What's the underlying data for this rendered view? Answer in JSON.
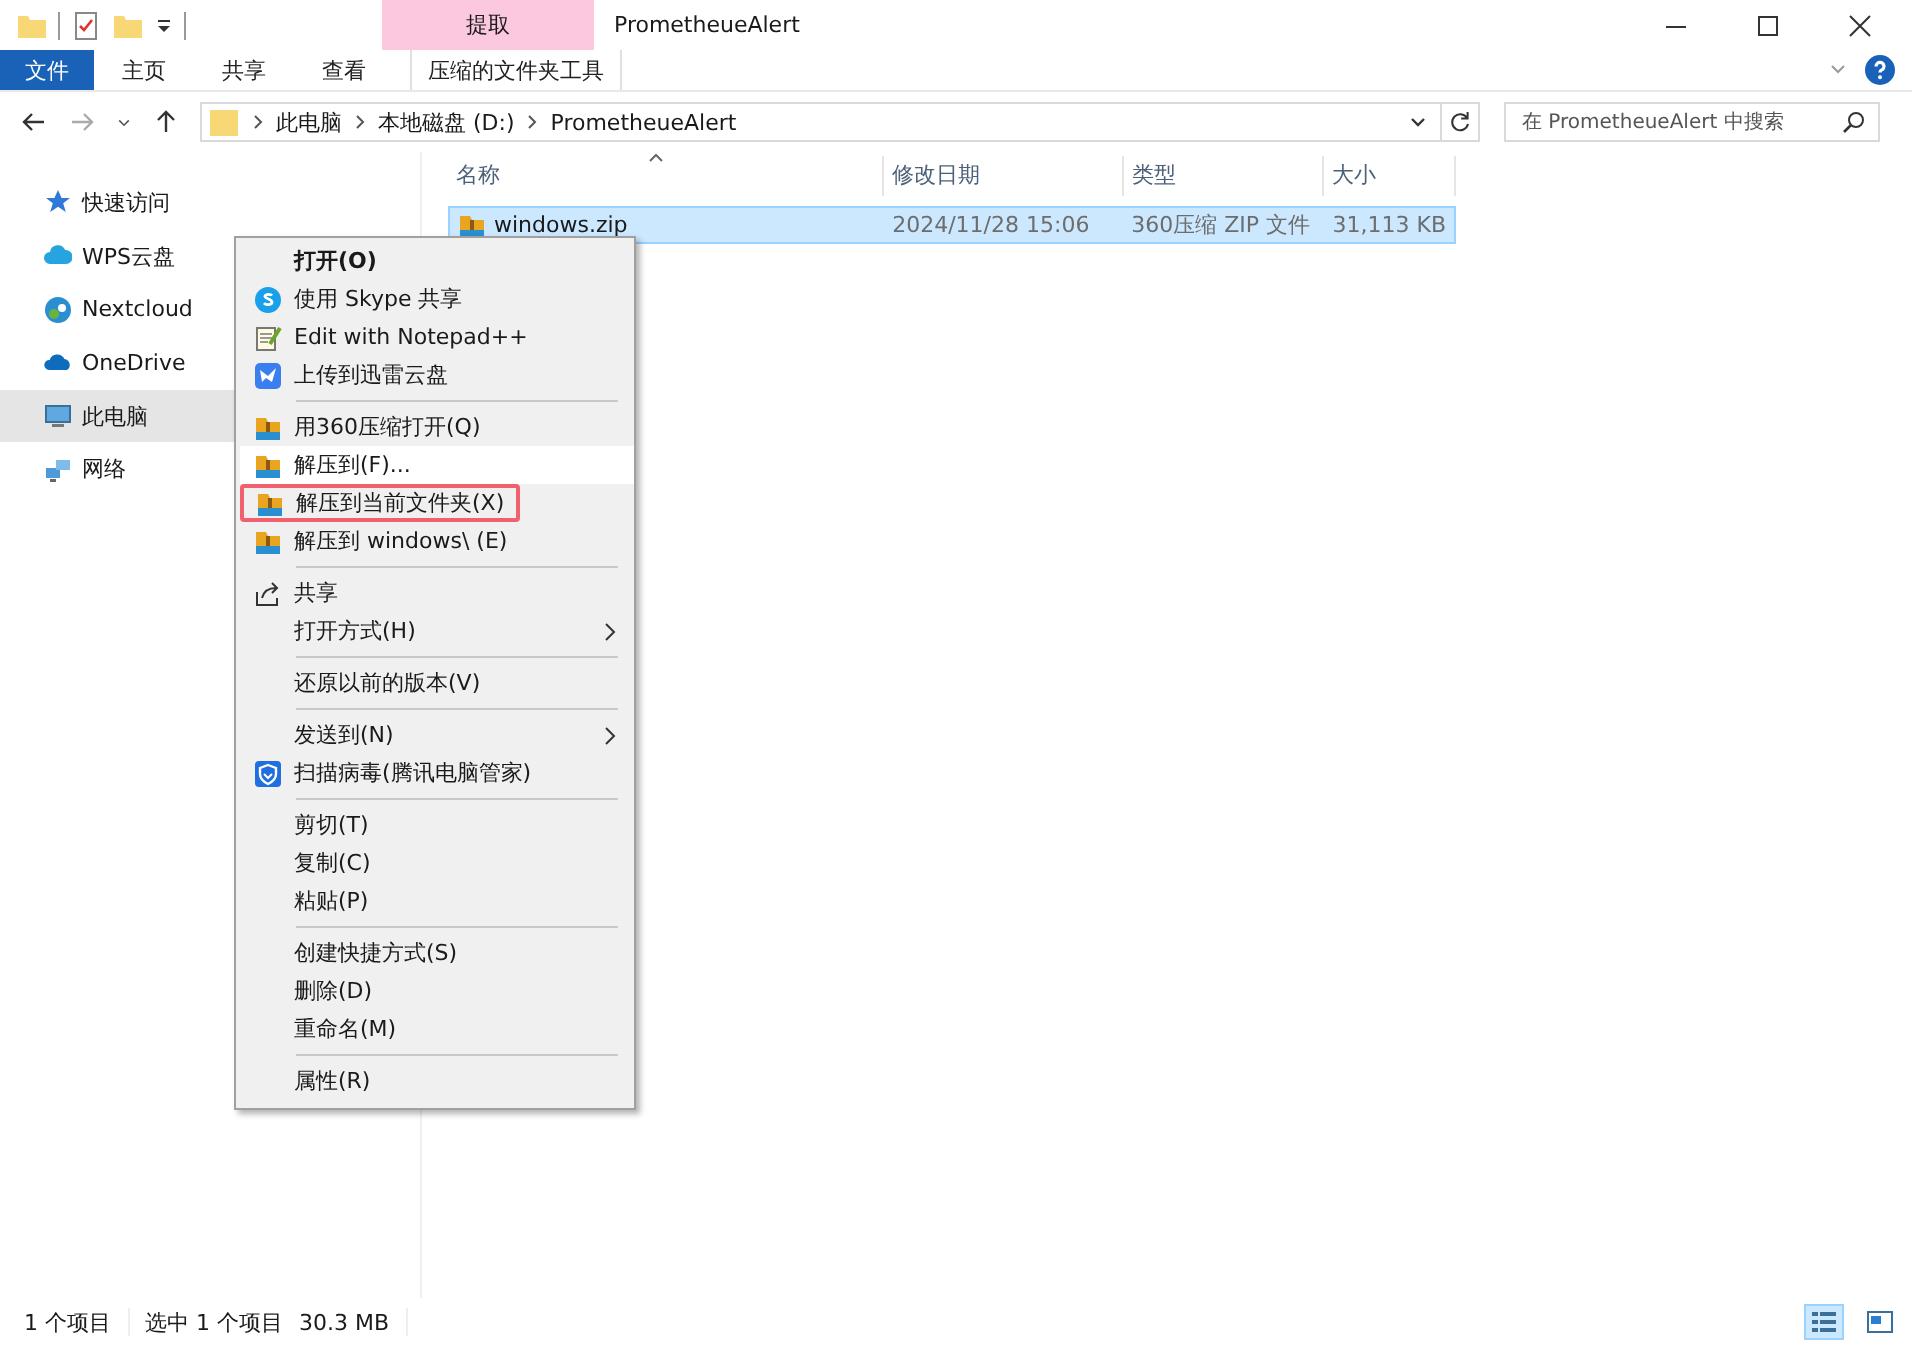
{
  "window": {
    "title": "PrometheueAlert"
  },
  "context_tab": {
    "label": "提取"
  },
  "ribbon_tabs": [
    {
      "label": "文件",
      "kind": "file",
      "selected": false
    },
    {
      "label": "主页",
      "kind": "normal",
      "selected": false
    },
    {
      "label": "共享",
      "kind": "normal",
      "selected": false
    },
    {
      "label": "查看",
      "kind": "normal",
      "selected": false
    },
    {
      "label": "压缩的文件夹工具",
      "kind": "context",
      "selected": false
    }
  ],
  "address": {
    "crumbs": [
      "此电脑",
      "本地磁盘 (D:)",
      "PrometheueAlert"
    ]
  },
  "search": {
    "placeholder": "在 PrometheueAlert 中搜索"
  },
  "sidebar": {
    "items": [
      {
        "label": "快速访问",
        "kind": "star",
        "selected": false
      },
      {
        "label": "WPS云盘",
        "kind": "cloud",
        "selected": false
      },
      {
        "label": "Nextcloud",
        "kind": "nextcloud",
        "selected": false
      },
      {
        "label": "OneDrive",
        "kind": "onedrive",
        "selected": false
      },
      {
        "label": "此电脑",
        "kind": "pc",
        "selected": true
      },
      {
        "label": "网络",
        "kind": "network",
        "selected": false
      }
    ]
  },
  "table": {
    "columns": [
      "名称",
      "修改日期",
      "类型",
      "大小"
    ],
    "rows": [
      {
        "name": "windows.zip",
        "date": "2024/11/28 15:06",
        "type": "360压缩 ZIP 文件",
        "size": "31,113 KB",
        "selected": true
      }
    ]
  },
  "context_menu": {
    "groups": [
      [
        {
          "label": "打开(O)",
          "kind": "plain",
          "bold": true,
          "hover": false,
          "outlined": false,
          "submenu": false
        },
        {
          "label": "使用 Skype 共享",
          "kind": "skype",
          "bold": false,
          "hover": false,
          "outlined": false,
          "submenu": false
        },
        {
          "label": "Edit with Notepad++",
          "kind": "notepad",
          "bold": false,
          "hover": false,
          "outlined": false,
          "submenu": false
        },
        {
          "label": "上传到迅雷云盘",
          "kind": "bird",
          "bold": false,
          "hover": false,
          "outlined": false,
          "submenu": false
        }
      ],
      [
        {
          "label": "用360压缩打开(Q)",
          "kind": "archive",
          "bold": false,
          "hover": false,
          "outlined": false,
          "submenu": false
        },
        {
          "label": "解压到(F)...",
          "kind": "archive",
          "bold": false,
          "hover": true,
          "outlined": false,
          "submenu": false
        },
        {
          "label": "解压到当前文件夹(X)",
          "kind": "archive",
          "bold": false,
          "hover": false,
          "outlined": true,
          "submenu": false
        },
        {
          "label": "解压到 windows\\ (E)",
          "kind": "archive",
          "bold": false,
          "hover": false,
          "outlined": false,
          "submenu": false
        }
      ],
      [
        {
          "label": "共享",
          "kind": "share",
          "bold": false,
          "hover": false,
          "outlined": false,
          "submenu": false
        },
        {
          "label": "打开方式(H)",
          "kind": "plain",
          "bold": false,
          "hover": false,
          "outlined": false,
          "submenu": true
        }
      ],
      [
        {
          "label": "还原以前的版本(V)",
          "kind": "plain",
          "bold": false,
          "hover": false,
          "outlined": false,
          "submenu": false
        }
      ],
      [
        {
          "label": "发送到(N)",
          "kind": "plain",
          "bold": false,
          "hover": false,
          "outlined": false,
          "submenu": true
        },
        {
          "label": "扫描病毒(腾讯电脑管家)",
          "kind": "shield",
          "bold": false,
          "hover": false,
          "outlined": false,
          "submenu": false
        }
      ],
      [
        {
          "label": "剪切(T)",
          "kind": "plain",
          "bold": false,
          "hover": false,
          "outlined": false,
          "submenu": false
        },
        {
          "label": "复制(C)",
          "kind": "plain",
          "bold": false,
          "hover": false,
          "outlined": false,
          "submenu": false
        },
        {
          "label": "粘贴(P)",
          "kind": "plain",
          "bold": false,
          "hover": false,
          "outlined": false,
          "submenu": false
        }
      ],
      [
        {
          "label": "创建快捷方式(S)",
          "kind": "plain",
          "bold": false,
          "hover": false,
          "outlined": false,
          "submenu": false
        },
        {
          "label": "删除(D)",
          "kind": "plain",
          "bold": false,
          "hover": false,
          "outlined": false,
          "submenu": false
        },
        {
          "label": "重命名(M)",
          "kind": "plain",
          "bold": false,
          "hover": false,
          "outlined": false,
          "submenu": false
        }
      ],
      [
        {
          "label": "属性(R)",
          "kind": "plain",
          "bold": false,
          "hover": false,
          "outlined": false,
          "submenu": false
        }
      ]
    ]
  },
  "status_bar": {
    "items": [
      "1 个项目",
      "选中 1 个项目",
      "30.3 MB"
    ],
    "views": [
      {
        "kind": "details",
        "selected": true
      },
      {
        "kind": "tiles",
        "selected": false
      }
    ]
  }
}
